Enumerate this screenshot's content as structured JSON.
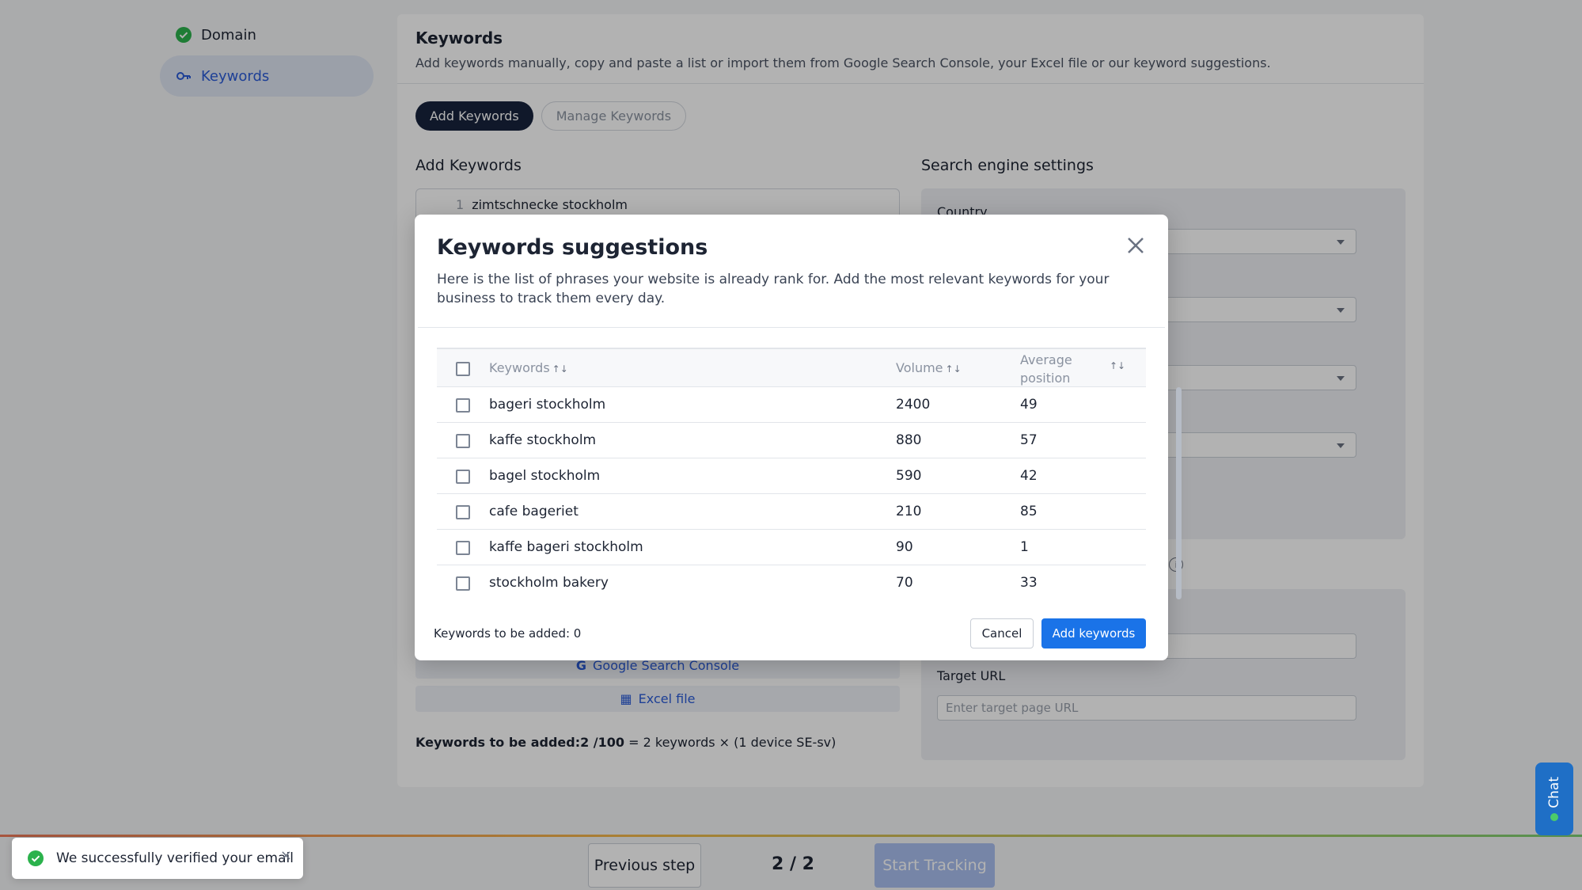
{
  "sidebar": {
    "items": [
      {
        "label": "Domain",
        "icon": "check-circle-icon",
        "status": "done"
      },
      {
        "label": "Keywords",
        "icon": "key-icon",
        "status": "active"
      }
    ]
  },
  "panel": {
    "title": "Keywords",
    "description": "Add keywords manually, copy and paste a list or import them from Google Search Console, your Excel file or our keyword suggestions.",
    "tabs": [
      {
        "label": "Add Keywords"
      },
      {
        "label": "Manage Keywords"
      }
    ],
    "add_keywords_heading": "Add Keywords",
    "editor_line_number": "1",
    "editor_first_line": "zimtschnecke stockholm",
    "import_gsc": "Google Search Console",
    "import_excel": "Excel file",
    "count_bold": "Keywords to be added:2 /100",
    "count_rest": " = 2 keywords × (1 device SE-sv)",
    "search_engine_heading": "Search engine settings",
    "country_label": "Country",
    "target_url_label": "Target URL",
    "target_url_placeholder": "Enter target page URL"
  },
  "footer": {
    "previous": "Previous step",
    "step": "2 / 2",
    "start": "Start Tracking"
  },
  "toast": {
    "message": "We successfully verified your email",
    "close": "×"
  },
  "chat": {
    "label": "Chat"
  },
  "modal": {
    "title": "Keywords suggestions",
    "description": "Here is the list of phrases your website is already rank for. Add the most relevant keywords for your business to track them every day.",
    "columns": {
      "keywords": "Keywords",
      "volume": "Volume",
      "position_line1": "Average",
      "position_line2": "position"
    },
    "rows": [
      {
        "keyword": "bageri stockholm",
        "volume": "2400",
        "position": "49"
      },
      {
        "keyword": "kaffe stockholm",
        "volume": "880",
        "position": "57"
      },
      {
        "keyword": "bagel stockholm",
        "volume": "590",
        "position": "42"
      },
      {
        "keyword": "cafe bageriet",
        "volume": "210",
        "position": "85"
      },
      {
        "keyword": "kaffe bageri stockholm",
        "volume": "90",
        "position": "1"
      },
      {
        "keyword": "stockholm bakery",
        "volume": "70",
        "position": "33"
      }
    ],
    "count": "Keywords to be added: 0",
    "cancel": "Cancel",
    "add": "Add keywords"
  },
  "colors": {
    "primary": "#1a73e8",
    "dark": "#17233d",
    "success": "#2bb24c"
  }
}
